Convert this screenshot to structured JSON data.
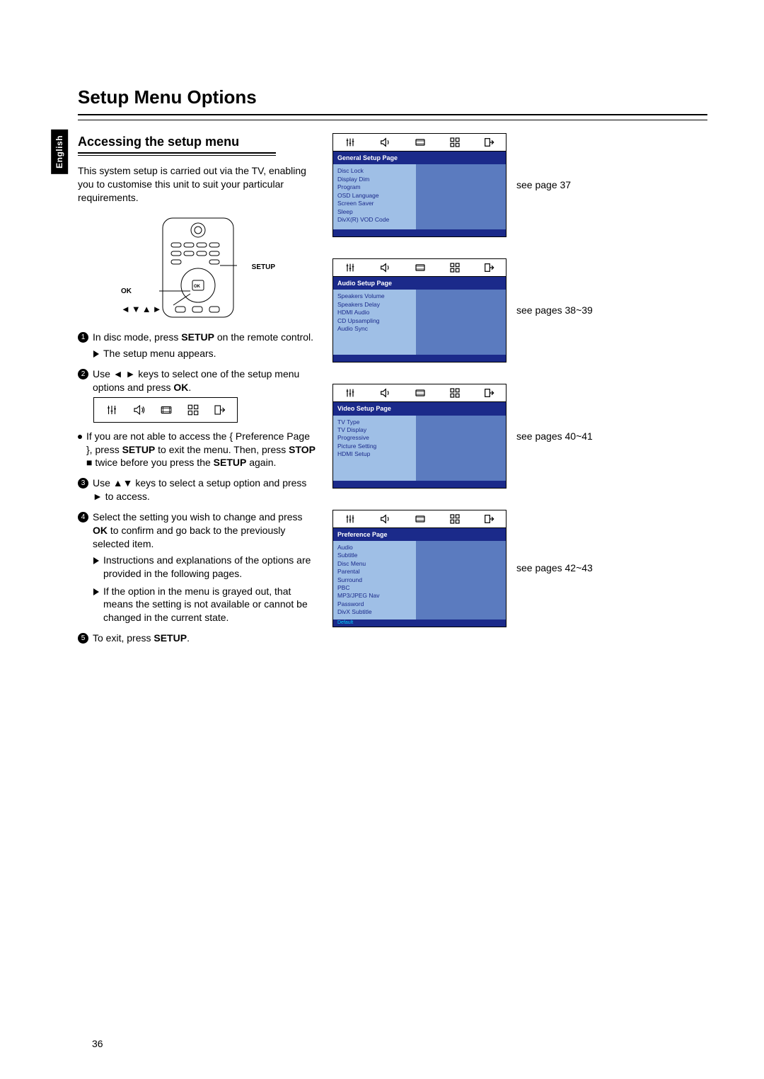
{
  "language_tab": "English",
  "title": "Setup Menu Options",
  "subtitle": "Accessing the setup menu",
  "intro": "This system setup is carried out via the TV, enabling you to customise this unit to suit your particular requirements.",
  "remote": {
    "ok_label": "OK",
    "setup_label": "SETUP",
    "nav_label": "◄▼▲►"
  },
  "steps": {
    "s1_a": "In disc mode, press ",
    "s1_b": "SETUP",
    "s1_c": " on the remote control.",
    "s1_result": "The setup menu appears.",
    "s2_a": "Use ◄ ► keys to select one of the setup menu options and press ",
    "s2_b": "OK",
    "s2_c": ".",
    "note_a": "If you are not able to access the { Preference Page }, press ",
    "note_b": "SETUP",
    "note_c": " to exit the menu. Then, press ",
    "note_d": "STOP",
    "note_e": " ■ twice before you press the ",
    "note_f": "SETUP",
    "note_g": " again.",
    "s3": "Use ▲▼ keys to select a setup option and press ► to access.",
    "s4_a": "Select the setting you wish to change and press ",
    "s4_b": "OK",
    "s4_c": " to confirm and go back to the previously selected item.",
    "s4_r1": "Instructions and explanations of the options are provided in the following pages.",
    "s4_r2": "If the option in the menu is grayed out, that means the setting is not available or cannot be changed in the current state.",
    "s5_a": "To exit, press ",
    "s5_b": "SETUP",
    "s5_c": "."
  },
  "panels": [
    {
      "title": "General Setup Page",
      "items": [
        "Disc Lock",
        "Display Dim",
        "Program",
        "OSD Language",
        "Screen Saver",
        "Sleep",
        "DivX(R) VOD Code"
      ],
      "note": "see page 37",
      "footer": ""
    },
    {
      "title": "Audio Setup Page",
      "items": [
        "Speakers Volume",
        "Speakers Delay",
        "HDMI Audio",
        "CD Upsampling",
        "Audio Sync"
      ],
      "note": "see pages 38~39",
      "footer": ""
    },
    {
      "title": "Video Setup Page",
      "items": [
        "TV Type",
        "TV Display",
        "Progressive",
        "Picture Setting",
        "HDMI Setup"
      ],
      "note": "see pages 40~41",
      "footer": ""
    },
    {
      "title": "Preference Page",
      "items": [
        "Audio",
        "Subtitle",
        "Disc Menu",
        "Parental",
        "Surround",
        "PBC",
        "MP3/JPEG Nav",
        "Password",
        "DivX Subtitle"
      ],
      "note": "see pages 42~43",
      "footer": "Default"
    }
  ],
  "page_number": "36"
}
